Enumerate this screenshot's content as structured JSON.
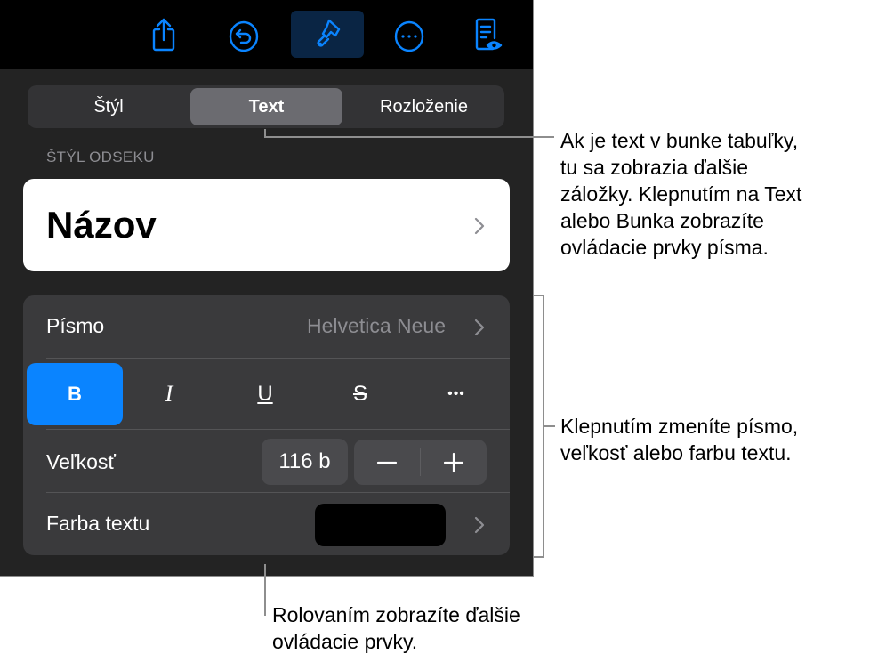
{
  "toolbar": {
    "buttons": [
      {
        "name": "share",
        "icon": "share-icon"
      },
      {
        "name": "undo",
        "icon": "undo-icon"
      },
      {
        "name": "format",
        "icon": "paintbrush-icon",
        "active": true
      },
      {
        "name": "more",
        "icon": "ellipsis-circle-icon"
      },
      {
        "name": "reading-view",
        "icon": "document-eye-icon"
      }
    ],
    "accent_color": "#0a84ff"
  },
  "tabs": [
    {
      "label": "Štýl",
      "active": false
    },
    {
      "label": "Text",
      "active": true
    },
    {
      "label": "Rozloženie",
      "active": false
    }
  ],
  "paragraph_style": {
    "section_label": "ŠTÝL ODSEKU",
    "value": "Názov"
  },
  "font": {
    "label": "Písmo",
    "value": "Helvetica Neue"
  },
  "format_buttons": [
    {
      "label": "B",
      "name": "bold",
      "active": true
    },
    {
      "label": "I",
      "name": "italic",
      "active": false
    },
    {
      "label": "U",
      "name": "underline",
      "active": false
    },
    {
      "label": "S",
      "name": "strikethrough",
      "active": false
    },
    {
      "label": "•••",
      "name": "more-options",
      "active": false
    }
  ],
  "size": {
    "label": "Veľkosť",
    "value": "116 b",
    "decrement": "−",
    "increment": "+"
  },
  "text_color": {
    "label": "Farba textu",
    "value": "#000000"
  },
  "callouts": {
    "tabs": "Ak je text v bunke tabuľky, tu sa zobrazia ďalšie záložky. Klepnutím na Text alebo Bunka zobrazíte ovládacie prvky písma.",
    "tabs_lines": [
      "Ak je text v bunke tabuľky,",
      "tu sa zobrazia ďalšie",
      "záložky. Klepnutím na Text",
      "alebo Bunka zobrazíte",
      "ovládacie prvky písma."
    ],
    "font_controls_lines": [
      "Klepnutím zmeníte písmo,",
      "veľkosť alebo farbu textu."
    ],
    "scroll_lines": [
      "Rolovaním zobrazíte ďalšie",
      "ovládacie prvky."
    ]
  }
}
